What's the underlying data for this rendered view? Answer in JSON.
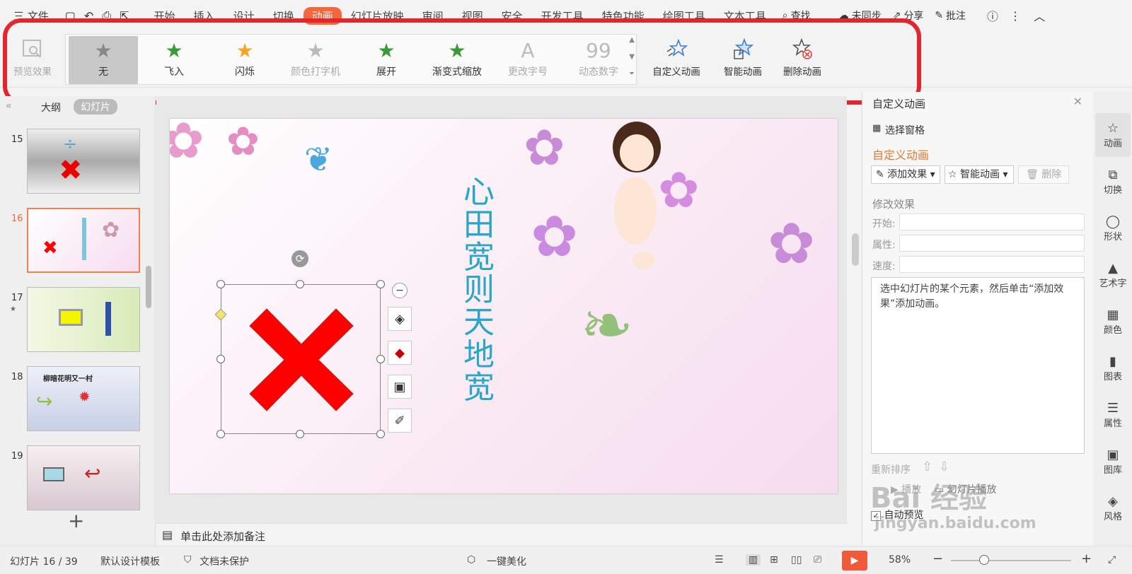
{
  "menubar": {
    "items": [
      "三 文件",
      "开始",
      "插入",
      "设计",
      "切换",
      "动画",
      "幻灯片放映",
      "审阅",
      "视图",
      "安全",
      "开发工具",
      "特色功能",
      "绘图工具",
      "文本工具"
    ],
    "active_index": 5,
    "search": "查找",
    "sync": "未同步",
    "share": "分享",
    "annotate": "批注"
  },
  "ribbon": {
    "preview": "预览效果",
    "gallery": [
      "无",
      "飞入",
      "闪烁",
      "颜色打字机",
      "展开",
      "渐变式缩放",
      "更改字号",
      "动态数字"
    ],
    "gallery_selected": 0,
    "gallery_disabled": [
      3,
      6,
      7
    ],
    "custom_anim": "自定义动画",
    "smart_anim": "智能动画",
    "delete_anim": "删除动画"
  },
  "left_pane": {
    "tabs": [
      "大纲",
      "幻灯片"
    ],
    "slides": [
      {
        "num": "15"
      },
      {
        "num": "16"
      },
      {
        "num": "17"
      },
      {
        "num": "18"
      },
      {
        "num": "19"
      }
    ],
    "selected_slide": "16",
    "slide18_text": "柳暗花明又一村",
    "add": "+"
  },
  "slide": {
    "vertical_text": "心田宽则天地宽"
  },
  "notes": "单击此处添加备注",
  "right_pane": {
    "title": "自定义动画",
    "select_pane": "选择窗格",
    "section": "自定义动画",
    "add_effect": "添加效果",
    "smart_anim": "智能动画",
    "delete": "删除",
    "modify": "修改效果",
    "start": "开始:",
    "property": "属性:",
    "speed": "速度:",
    "hint": "选中幻灯片的某个元素，然后单击“添加效果”添加动画。",
    "reorder": "重新排序",
    "play": "播放",
    "slideshow": "幻灯片播放",
    "auto_preview": "自动预览"
  },
  "sidebar": [
    "动画",
    "切换",
    "形状",
    "艺术字",
    "颜色",
    "图表",
    "属性",
    "图库",
    "风格"
  ],
  "status": {
    "slide_info": "幻灯片 16 / 39",
    "template": "默认设计模板",
    "protect": "文档未保护",
    "beautify": "一键美化",
    "zoom": "58%"
  },
  "watermark": {
    "brand": "Bai  经验",
    "url": "jingyan.baidu.com"
  },
  "colors": {
    "accent": "#f0683c",
    "highlight": "#e4252d",
    "shape": "#ff0000",
    "title_text": "#2aa6c8"
  }
}
